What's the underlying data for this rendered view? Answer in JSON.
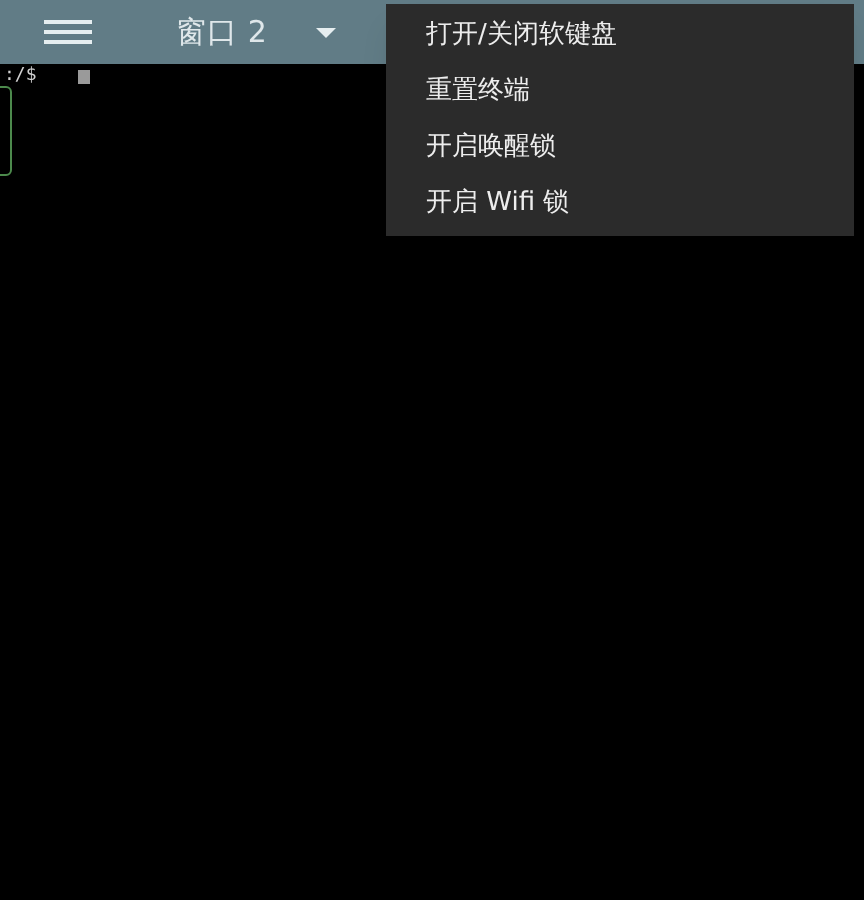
{
  "toolbar": {
    "title": "窗口 2"
  },
  "terminal": {
    "prompt": ":/$"
  },
  "menu": {
    "items": [
      {
        "label": "打开/关闭软键盘"
      },
      {
        "label": "重置终端"
      },
      {
        "label": "开启唤醒锁"
      },
      {
        "label": "开启 Wifi 锁"
      }
    ]
  }
}
